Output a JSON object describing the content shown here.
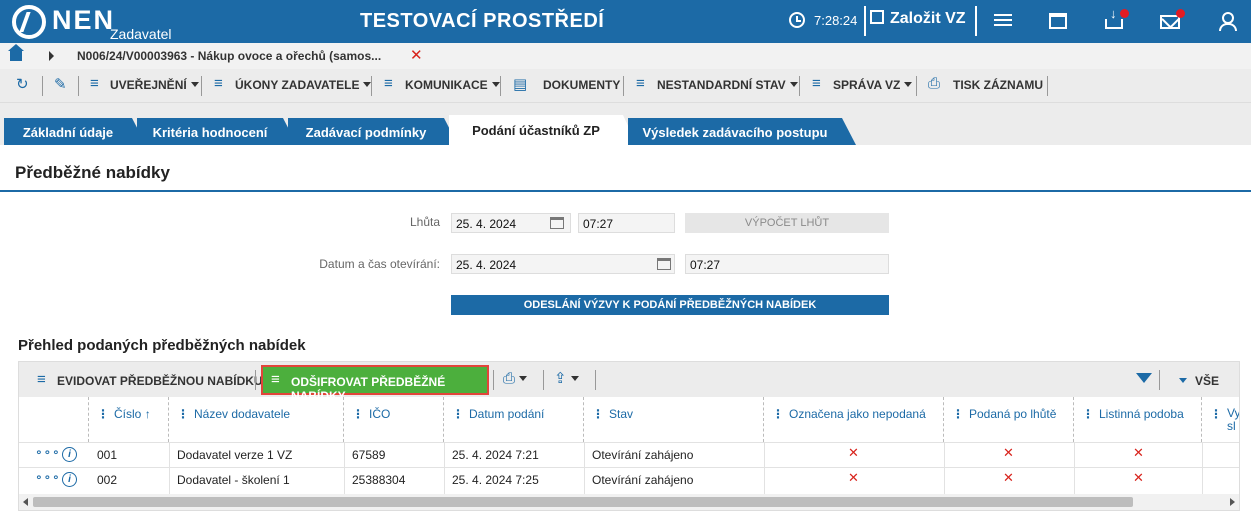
{
  "header": {
    "brand": "NEN",
    "brand_sub": "Zadavatel",
    "environment": "TESTOVACÍ PROSTŘEDÍ",
    "time": "7:28:24",
    "create_label": "Založit VZ",
    "accent_color": "#1c6aa6"
  },
  "breadcrumb": {
    "text": "N006/24/V00003963 - Nákup ovoce a ořechů (samos...",
    "close": "✕"
  },
  "toolbar": {
    "items": [
      "UVEŘEJNĚNÍ",
      "ÚKONY ZADAVATELE",
      "KOMUNIKACE",
      "DOKUMENTY",
      "NESTANDARDNÍ STAV",
      "SPRÁVA VZ",
      "TISK ZÁZNAMU"
    ]
  },
  "tabs": [
    {
      "label": "Základní údaje"
    },
    {
      "label": "Kritéria hodnocení"
    },
    {
      "label": "Zadávací podmínky"
    },
    {
      "label": "Podání účastníků ZP"
    },
    {
      "label": "Výsledek zadávacího postupu"
    }
  ],
  "section": {
    "title": "Předběžné nabídky",
    "deadline_label": "Lhůta",
    "deadline_date": "25. 4. 2024",
    "deadline_time": "07:27",
    "calc_button": "VÝPOČET LHŮT",
    "opening_label": "Datum a čas otevírání:",
    "opening_date": "25. 4. 2024",
    "opening_time": "07:27",
    "send_button": "ODESLÁNÍ VÝZVY K PODÁNÍ PŘEDBĚŽNÝCH NABÍDEK"
  },
  "overview": {
    "title": "Přehled podaných předběžných nabídek",
    "register_button": "EVIDOVAT PŘEDBĚŽNOU NABÍDKU",
    "decrypt_button": "ODŠIFROVAT PŘEDBĚŽNÉ NABÍDKY",
    "all_label": "VŠE",
    "columns": [
      "Číslo",
      "Název dodavatele",
      "IČO",
      "Datum podání",
      "Stav",
      "Označena jako nepodaná",
      "Podaná po lhůtě",
      "Listinná podoba",
      "Vy sl"
    ],
    "sort_indicator": "↑",
    "rows": [
      {
        "number": "001",
        "supplier": "Dodavatel verze 1 VZ",
        "ico": "67589",
        "date": "25. 4. 2024 7:21",
        "status": "Otevírání zahájeno",
        "not_submitted": "✕",
        "late": "✕",
        "paper": "✕"
      },
      {
        "number": "002",
        "supplier": "Dodavatel - školení 1",
        "ico": "25388304",
        "date": "25. 4. 2024 7:25",
        "status": "Otevírání zahájeno",
        "not_submitted": "✕",
        "late": "✕",
        "paper": "✕"
      }
    ]
  }
}
